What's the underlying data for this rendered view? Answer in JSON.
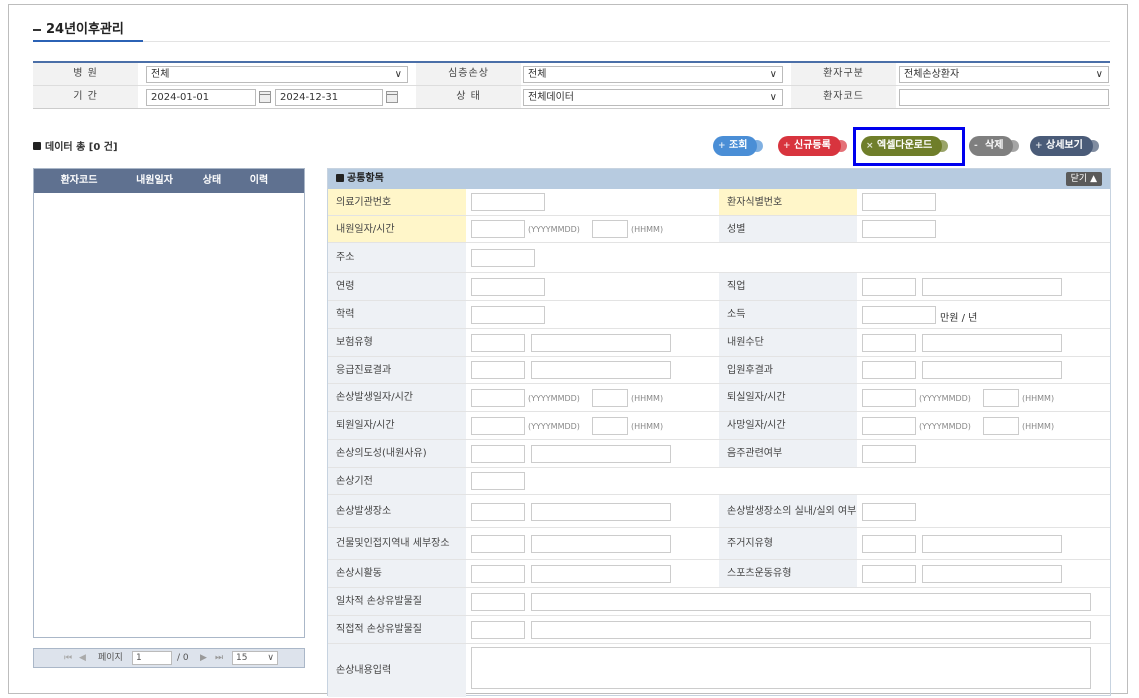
{
  "page": {
    "title": "24년이후관리"
  },
  "search": {
    "hospital_label": "병    원",
    "hospital_value": "전체",
    "injury_label": "심층손상",
    "injury_value": "전체",
    "ptype_label": "환자구분",
    "ptype_value": "전체손상환자",
    "period_label": "기    간",
    "date_from": "2024-01-01",
    "date_to": "2024-12-31",
    "status_label": "상    태",
    "status_value": "전체데이터",
    "pcode_label": "환자코드",
    "pcode_value": ""
  },
  "count_text": "데이터 총 [0 건]",
  "buttons": {
    "search": "조회",
    "new": "신규등록",
    "excel": "엑셀다운로드",
    "delete": "삭제",
    "detail": "상세보기"
  },
  "left_grid": {
    "columns": [
      "환자코드",
      "내원일자",
      "상태",
      "이력"
    ],
    "pager": {
      "page_label": "페이지",
      "page": "1",
      "total": "/ 0",
      "page_size": "15"
    }
  },
  "panel": {
    "title": "공통항목",
    "close": "닫기 ▲"
  },
  "form": {
    "l_org": "의료기관번호",
    "l_pid": "환자식별번호",
    "l_visit": "내원일자/시간",
    "l_sex": "성별",
    "l_addr": "주소",
    "l_age": "연령",
    "l_job": "직업",
    "l_edu": "학력",
    "l_income": "소득",
    "income_unit": "만원 / 년",
    "l_ins": "보험유형",
    "l_arrival": "내원수단",
    "l_er": "응급진료결과",
    "l_adm": "입원후결과",
    "l_injtime": "손상발생일자/시간",
    "l_out": "퇴실일자/시간",
    "l_disch": "퇴원일자/시간",
    "l_death": "사망일자/시간",
    "l_intent": "손상의도성(내원사유)",
    "l_alcohol": "음주관련여부",
    "l_mech": "손상기전",
    "l_place": "손상발생장소",
    "l_inout": "손상발생장소의 실내/실외 여부",
    "l_bldg": "건물및인접지역내 세부장소",
    "l_home": "주거지유형",
    "l_act": "손상시활동",
    "l_sport": "스포츠운동유형",
    "l_prim": "일차적 손상유발물질",
    "l_direct": "직접적 손상유발물질",
    "l_desc": "손상내용입력",
    "hint_date": "(YYYYMMDD)",
    "hint_time": "(HHMM)"
  }
}
